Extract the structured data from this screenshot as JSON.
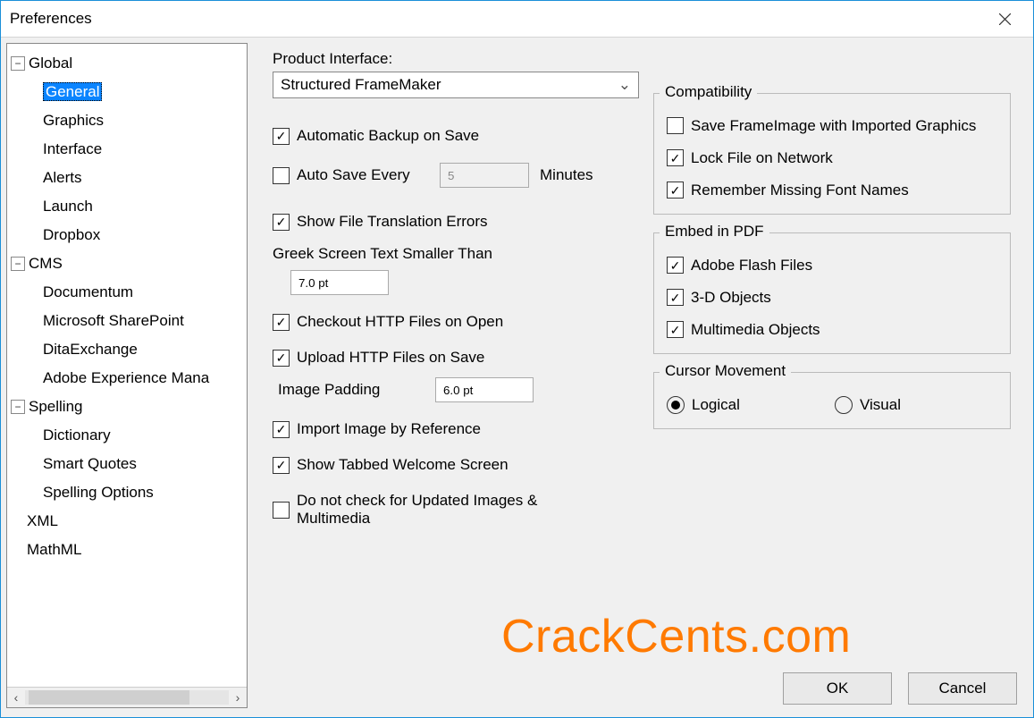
{
  "window": {
    "title": "Preferences"
  },
  "tree": {
    "global": {
      "label": "Global",
      "items": [
        "General",
        "Graphics",
        "Interface",
        "Alerts",
        "Launch",
        "Dropbox"
      ],
      "selected_index": 0
    },
    "cms": {
      "label": "CMS",
      "items": [
        "Documentum",
        "Microsoft SharePoint",
        "DitaExchange",
        "Adobe Experience Mana"
      ]
    },
    "spelling": {
      "label": "Spelling",
      "items": [
        "Dictionary",
        "Smart Quotes",
        "Spelling Options"
      ]
    },
    "xml": {
      "label": "XML"
    },
    "mathml": {
      "label": "MathML"
    }
  },
  "main": {
    "product_interface_label": "Product Interface:",
    "product_interface_value": "Structured FrameMaker",
    "auto_backup": "Automatic Backup on Save",
    "auto_save": "Auto Save Every",
    "auto_save_value": "5",
    "minutes": "Minutes",
    "show_translation_errors": "Show File Translation Errors",
    "greek_text_label": "Greek Screen Text Smaller Than",
    "greek_text_value": "7.0 pt",
    "checkout_http": "Checkout HTTP Files on Open",
    "upload_http": "Upload HTTP Files on Save",
    "image_padding_label": "Image Padding",
    "image_padding_value": "6.0 pt",
    "import_by_ref": "Import Image by Reference",
    "tabbed_welcome": "Show Tabbed Welcome Screen",
    "no_update_check": "Do not check for Updated Images & Multimedia"
  },
  "compat": {
    "legend": "Compatibility",
    "save_frameimage": "Save FrameImage with Imported Graphics",
    "lock_file": "Lock File on Network",
    "remember_fonts": "Remember Missing Font Names"
  },
  "embed": {
    "legend": "Embed in PDF",
    "flash": "Adobe Flash Files",
    "threed": "3-D Objects",
    "multimedia": "Multimedia Objects"
  },
  "cursor": {
    "legend": "Cursor Movement",
    "logical": "Logical",
    "visual": "Visual"
  },
  "buttons": {
    "ok": "OK",
    "cancel": "Cancel"
  },
  "watermark": "CrackCents.com"
}
